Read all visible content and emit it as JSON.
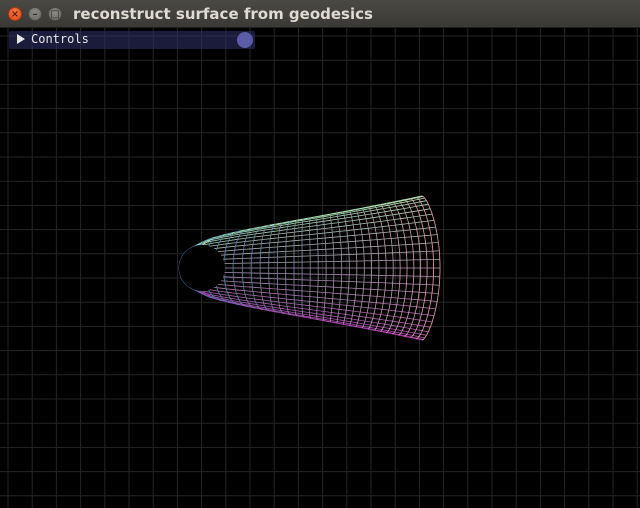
{
  "window": {
    "title": "reconstruct surface from geodesics"
  },
  "controls_panel": {
    "label": "Controls",
    "collapsed": true
  },
  "colors": {
    "background": "#000000",
    "grid": "#2a2a2a",
    "panel": "#32326e",
    "accent": "#5b5ba8"
  }
}
